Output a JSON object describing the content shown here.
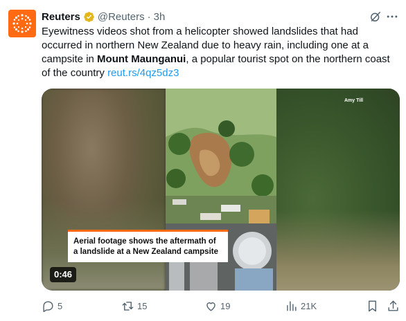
{
  "author": {
    "name": "Reuters",
    "handle": "@Reuters",
    "separator": "·",
    "time": "3h",
    "avatar_icon": "reuters-logo",
    "brand_color": "#ff6a13",
    "verified_icon": "gold-verified-badge"
  },
  "tweet": {
    "text_part1": "Eyewitness videos shot from a helicopter showed landslides that had occurred in northern New Zealand due to heavy rain, including one at a campsite in ",
    "bold_place": "Mount Maunganui",
    "text_part2": ", a popular tourist spot on the northern coast of the country ",
    "link": "reut.rs/4qz5dz3",
    "link_color": "#1d9bf0"
  },
  "media": {
    "video_credit": "Amy Till",
    "caption_line1": "Aerial footage shows the aftermath of",
    "caption_line2": "a landslide at a New Zealand campsite",
    "duration": "0:46"
  },
  "actions": {
    "replies": "5",
    "reposts": "15",
    "likes": "19",
    "views": "21K"
  },
  "icons": [
    "grok-icon",
    "more-icon",
    "reply-icon",
    "repost-icon",
    "like-icon",
    "views-icon",
    "bookmark-icon",
    "share-icon"
  ]
}
